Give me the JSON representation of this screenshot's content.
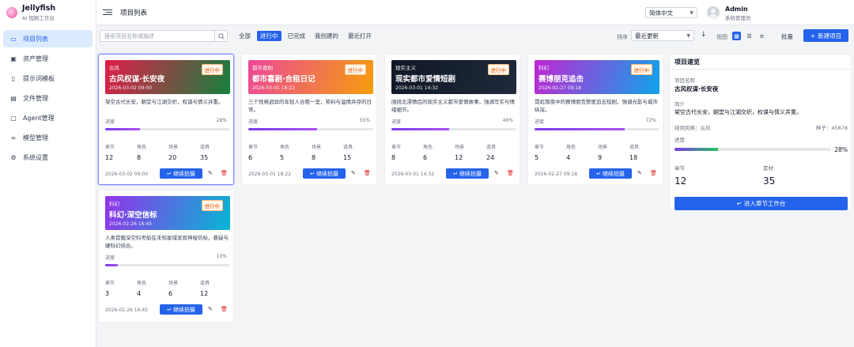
{
  "app": {
    "name": "Jellyfish",
    "subtitle": "AI 短剧工作台"
  },
  "sidebar": {
    "items": [
      {
        "label": "项目列表",
        "icon": "folder-icon",
        "active": true
      },
      {
        "label": "资产管理",
        "icon": "image-icon",
        "active": false
      },
      {
        "label": "提示词模板",
        "icon": "file-icon",
        "active": false
      },
      {
        "label": "文件管理",
        "icon": "file-manager-icon",
        "active": false
      },
      {
        "label": "Agent管理",
        "icon": "agent-icon",
        "active": false
      },
      {
        "label": "模型管理",
        "icon": "link-icon",
        "active": false
      },
      {
        "label": "系统设置",
        "icon": "gear-icon",
        "active": false
      }
    ]
  },
  "header": {
    "page_title": "项目列表",
    "language": "简体中文",
    "user_name": "Admin",
    "user_role": "系统管理员"
  },
  "toolbar": {
    "search_placeholder": "搜索项目名称或描述",
    "filters": [
      "全部",
      "进行中",
      "已完成",
      "我创建的",
      "最近打开"
    ],
    "active_filter": "进行中",
    "sort_label": "排序",
    "sort_value": "最近更新",
    "view_label": "视图",
    "batch_label": "批量",
    "new_label": "新建项目"
  },
  "stat_labels": [
    "章节",
    "角色",
    "场景",
    "道具"
  ],
  "progress_label": "进度",
  "projects": [
    {
      "genre": "古风",
      "title": "古风权谋·长安夜",
      "cover_date": "2026-03-02 09:00",
      "status": "进行中",
      "desc": "架空古代长安，朝堂与江湖交织，权谋与情义并重。",
      "progress": "28%",
      "progress_value": 28,
      "stats": [
        "12",
        "8",
        "20",
        "35"
      ],
      "date": "2026-03-02 09:00",
      "continue": "继续拍摄",
      "gradient": [
        "#e11d48",
        "#15803d"
      ]
    },
    {
      "genre": "都市喜剧",
      "title": "都市喜剧·合租日记",
      "cover_date": "2026-03-01 18:22",
      "status": "进行中",
      "desc": "三个性格迥异的年轻人合租一室，笑料与温情并存的日常。",
      "progress": "55%",
      "progress_value": 55,
      "stats": [
        "6",
        "5",
        "8",
        "15"
      ],
      "date": "2026-03-01 18:22",
      "continue": "继续拍摄",
      "gradient": [
        "#ec4899",
        "#f59e0b"
      ]
    },
    {
      "genre": "现实主义",
      "title": "现实都市爱情短剧",
      "cover_date": "2026-03-01 14:32",
      "status": "进行中",
      "desc": "围绕北漂情侣的现实主义都市爱情故事，强调写实与情绪细节。",
      "progress": "46%",
      "progress_value": 46,
      "stats": [
        "8",
        "6",
        "12",
        "24"
      ],
      "date": "2026-03-01 14:32",
      "continue": "继续拍摄",
      "gradient": [
        "#111827",
        "#1e293b"
      ]
    },
    {
      "genre": "科幻",
      "title": "赛博朋克追击",
      "cover_date": "2026-02-27 09:18",
      "status": "进行中",
      "desc": "霓虹雨夜中的赛博朋克警匪追击短剧，强调光影与城市纵深。",
      "progress": "72%",
      "progress_value": 72,
      "stats": [
        "5",
        "4",
        "9",
        "18"
      ],
      "date": "2026-02-27 09:18",
      "continue": "继续拍摄",
      "gradient": [
        "#c026d3",
        "#0ea5e9"
      ]
    },
    {
      "genre": "科幻",
      "title": "科幻·深空信标",
      "cover_date": "2026-02-26 16:45",
      "status": "进行中",
      "desc": "人类首艘深空科考船在未知星域发现神秘信标，悬疑与硬科幻结合。",
      "progress": "10%",
      "progress_value": 10,
      "stats": [
        "3",
        "4",
        "6",
        "12"
      ],
      "date": "2026-02-26 16:45",
      "continue": "继续拍摄",
      "gradient": [
        "#9333ea",
        "#06b6d4"
      ]
    }
  ],
  "overview": {
    "title": "项目速览",
    "name_label": "项目名称",
    "name": "古风权谋·长安夜",
    "intro_label": "简介",
    "intro": "架空古代长安，朝堂与江湖交织，权谋与情义并重。",
    "style": "视频风格：古风",
    "seed": "种子：45678",
    "progress_label": "进度",
    "progress": "28%",
    "progress_value": 28,
    "chapters_label": "章节",
    "chapters": "12",
    "assets_label": "素材",
    "assets": "35",
    "action": "进入章节工作台"
  }
}
